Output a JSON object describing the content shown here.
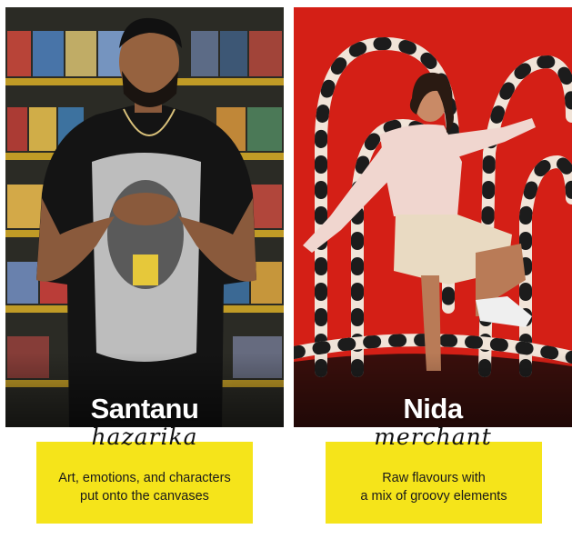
{
  "cards": [
    {
      "first_name": "Santanu",
      "last_name": "hazarika",
      "tagline_line1": "Art, emotions, and characters",
      "tagline_line2": "put onto the canvases"
    },
    {
      "first_name": "Nida",
      "last_name": "merchant",
      "tagline_line1": "Raw flavours with",
      "tagline_line2": "a mix of groovy elements"
    }
  ],
  "colors": {
    "tagline_bg": "#f5e41a",
    "left_bg": "#2b2b25",
    "right_bg": "#d41f16"
  }
}
